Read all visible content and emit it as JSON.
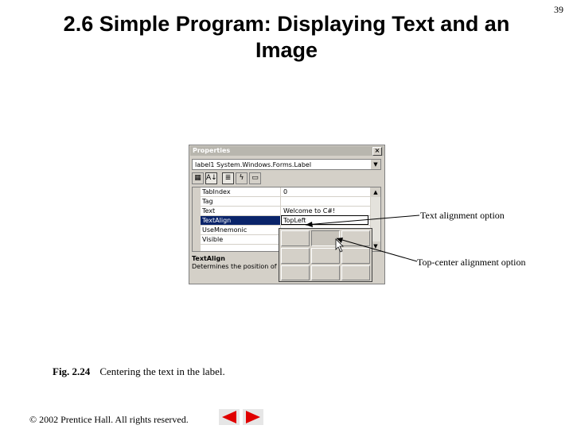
{
  "slide": {
    "title": "2.6  Simple Program: Displaying Text and an Image",
    "page_number": "39",
    "caption_label": "Fig. 2.24",
    "caption_text": "Centering the text in the label.",
    "copyright": "© 2002 Prentice Hall.  All rights reserved."
  },
  "properties_window": {
    "title": "Properties",
    "object_selector": "label1  System.Windows.Forms.Label",
    "toolbar": [
      {
        "icon": "categorized-icon",
        "glyph": "▦"
      },
      {
        "icon": "alphabetical-icon",
        "glyph": "A↓"
      },
      {
        "icon": "properties-icon",
        "glyph": "≣"
      },
      {
        "icon": "events-icon",
        "glyph": "ϟ"
      },
      {
        "icon": "property-pages-icon",
        "glyph": "▭"
      }
    ],
    "rows": [
      {
        "name": "TabIndex",
        "value": "0"
      },
      {
        "name": "Tag",
        "value": ""
      },
      {
        "name": "Text",
        "value": "Welcome to C#!"
      },
      {
        "name": "TextAlign",
        "value": "TopLeft",
        "selected": true
      },
      {
        "name": "UseMnemonic",
        "value": ""
      },
      {
        "name": "Visible",
        "value": ""
      }
    ],
    "description_title": "TextAlign",
    "description_text": "Determines the position of the"
  },
  "callouts": {
    "text_alignment": "Text alignment option",
    "top_center": "Top-center alignment option"
  },
  "colors": {
    "selection": "#0a246a",
    "window": "#d4d0c8",
    "nav_arrow": "#e00000"
  }
}
